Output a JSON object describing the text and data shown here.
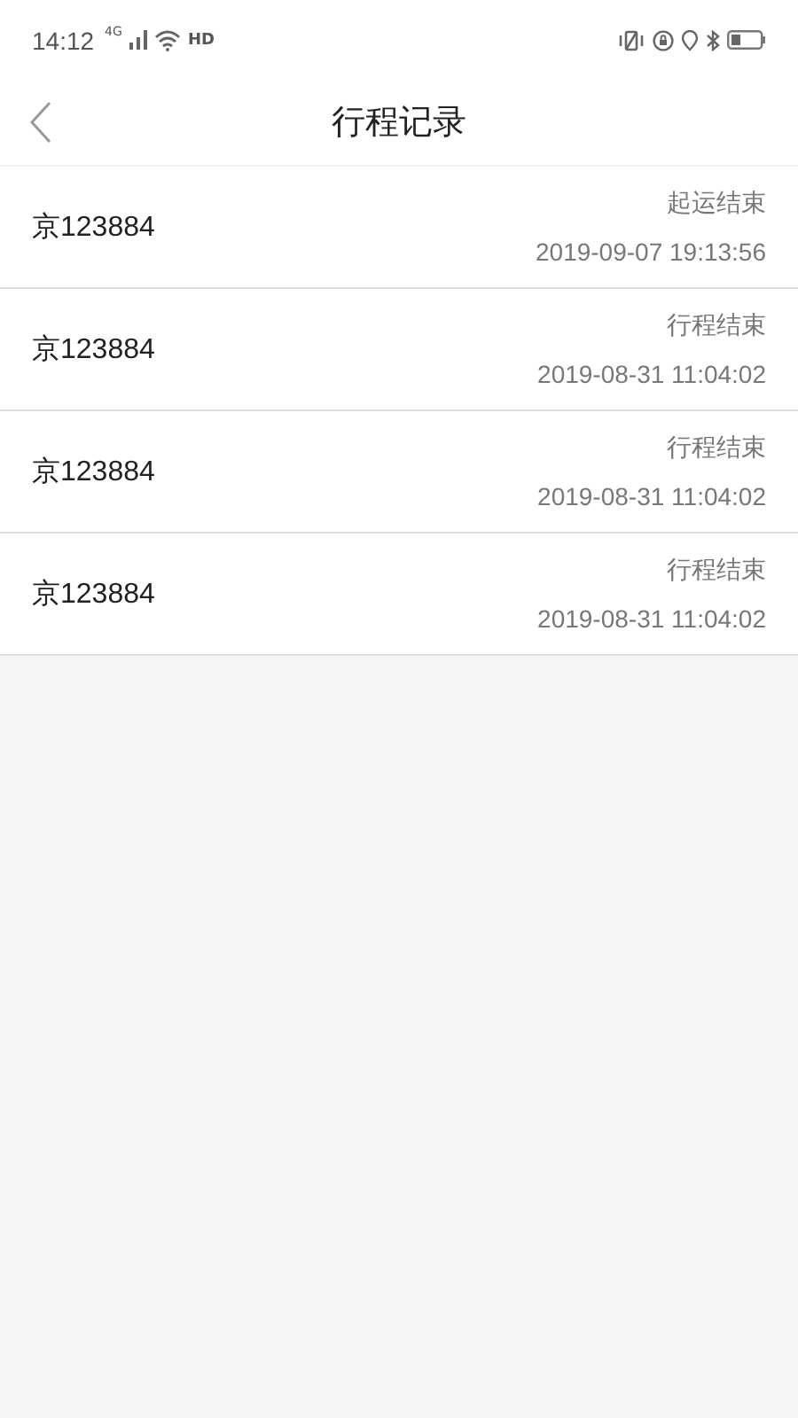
{
  "status_bar": {
    "time": "14:12",
    "network": "4G",
    "hd": "HD"
  },
  "header": {
    "title": "行程记录"
  },
  "trips": [
    {
      "plate": "京123884",
      "status": "起运结束",
      "time": "2019-09-07 19:13:56"
    },
    {
      "plate": "京123884",
      "status": "行程结束",
      "time": "2019-08-31 11:04:02"
    },
    {
      "plate": "京123884",
      "status": "行程结束",
      "time": "2019-08-31 11:04:02"
    },
    {
      "plate": "京123884",
      "status": "行程结束",
      "time": "2019-08-31 11:04:02"
    }
  ]
}
